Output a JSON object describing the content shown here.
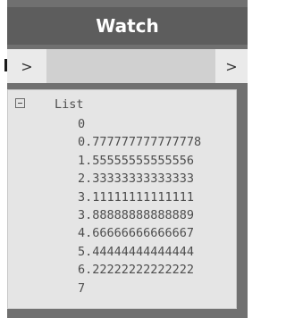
{
  "node": {
    "title": "Watch",
    "input_port_label": ">",
    "output_port_label": ">"
  },
  "watch": {
    "root_label": "List",
    "items": [
      "0",
      "0.777777777777778",
      "1.55555555555556",
      "2.33333333333333",
      "3.11111111111111",
      "3.88888888888889",
      "4.66666666666667",
      "5.44444444444444",
      "6.22222222222222",
      "7"
    ]
  },
  "colors": {
    "node_body": "#707070",
    "header": "#5d5d5d",
    "port_background": "#eaeaea",
    "watch_background": "#e5e5e5"
  }
}
